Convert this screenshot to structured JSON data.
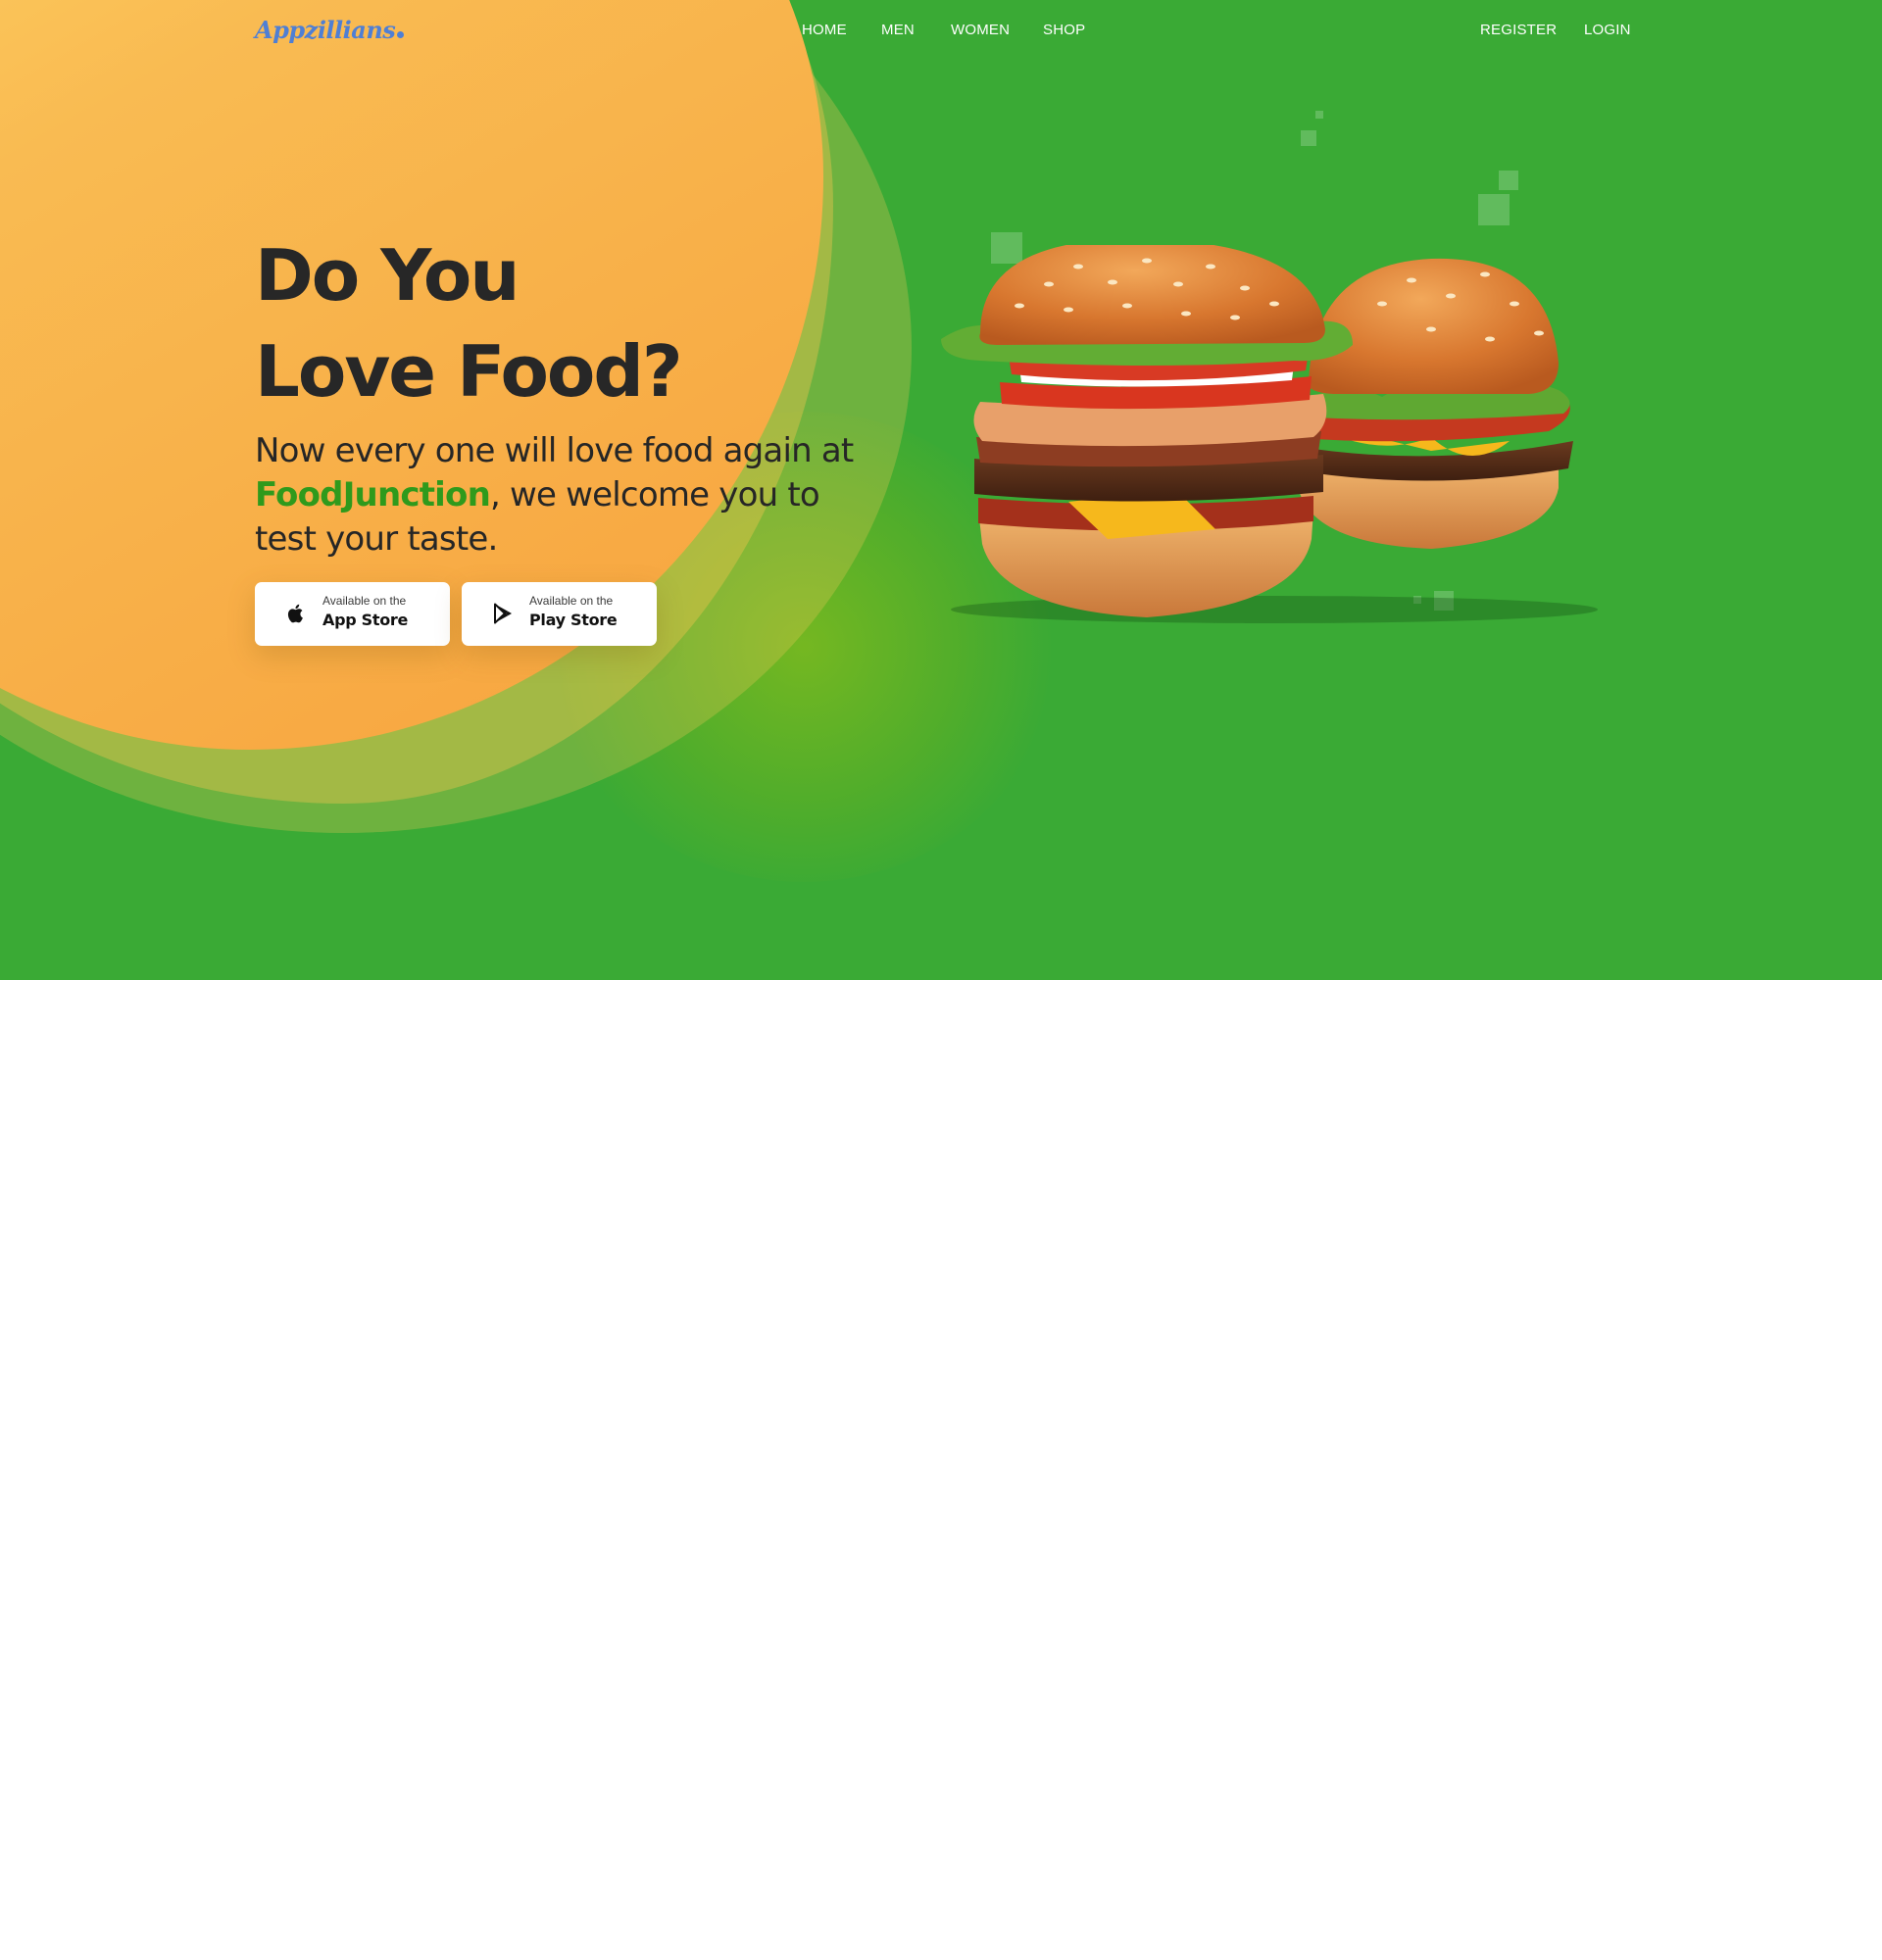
{
  "brand": {
    "logo_text": "Appzillians",
    "logo_color": "#4f7fd4"
  },
  "nav": {
    "primary": [
      "HOME",
      "MEN",
      "WOMEN",
      "SHOP"
    ],
    "account": [
      "REGISTER",
      "LOGIN"
    ]
  },
  "hero": {
    "headline_line1": "Do You",
    "headline_line2": "Love Food?",
    "subtext_before": "Now every one will love food again at ",
    "subtext_brand": "FoodJunction",
    "subtext_after": ", we welcome you to test your taste.",
    "image_subject": "two cheeseburgers"
  },
  "store_buttons": [
    {
      "small": "Available on the",
      "big": "App Store",
      "icon": "apple-icon"
    },
    {
      "small": "Available on the",
      "big": "Play Store",
      "icon": "play-store-icon"
    }
  ],
  "colors": {
    "hero_green": "#3aaa35",
    "blob_orange": "#f7a33e",
    "blob_yellow": "#ffdd6b",
    "brand_green": "#2f9a1c",
    "heading_dark": "#272727"
  }
}
